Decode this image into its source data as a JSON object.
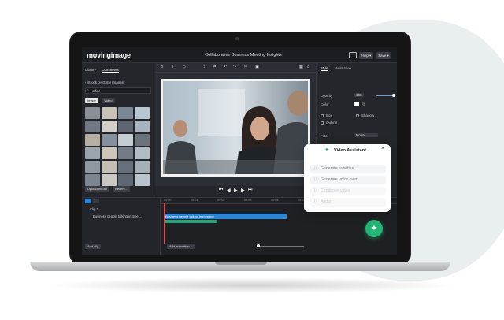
{
  "app": {
    "logo": "movingimage",
    "title": "Collaborative Business Meeting Insights"
  },
  "header": {
    "help_label": "Help ▾",
    "save_label": "Save ▾"
  },
  "left_panel": {
    "tabs": [
      "Library",
      "Comments"
    ],
    "back_link": "‹ iStock by Getty Images",
    "search": {
      "value": "office",
      "placeholder": "Search"
    },
    "filters": [
      "Image",
      "Video"
    ],
    "buttons": {
      "upload": "Upload media",
      "recent": "Recent..."
    }
  },
  "right_panel": {
    "tabs": [
      "Style",
      "Animation"
    ],
    "opacity_label": "Opacity",
    "opacity_value": "100",
    "color_label": "Color",
    "options": [
      "Box",
      "Shadow",
      "Outline"
    ],
    "filter_label": "Filter",
    "filter_value": "None"
  },
  "timeline": {
    "ticks": [
      "00:00",
      "00:01",
      "00:02",
      "00:03",
      "00:04",
      "00:05",
      "00:06",
      "00:07"
    ],
    "track_name": "Clip 1",
    "clip_label": "Business people talking in meet...",
    "clip_bar_label": "Business people talking in meeting",
    "add_clip": "Add clip",
    "add_animation": "Add animation +"
  },
  "assistant": {
    "title": "Video Assistant",
    "items": [
      {
        "label": "Generate subtitles",
        "icon": "subtitles-icon"
      },
      {
        "label": "Generate voice over",
        "icon": "voice-icon"
      },
      {
        "label": "Condense video",
        "icon": "condense-icon"
      },
      {
        "label": "Audio",
        "icon": "audio-icon"
      }
    ]
  },
  "colors": {
    "accent": "#22b573",
    "clip": "#2b87d6",
    "playhead": "#e24b4b"
  }
}
